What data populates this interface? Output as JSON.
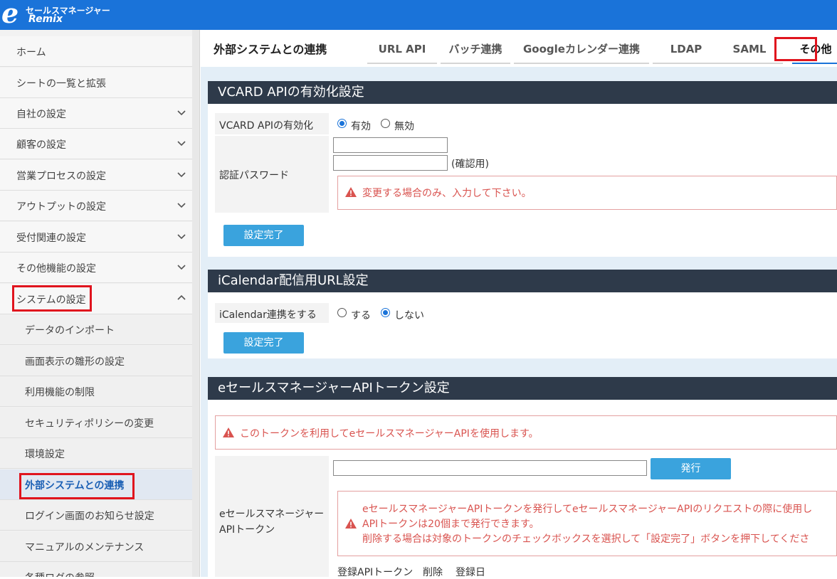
{
  "header": {
    "logo_e": "e",
    "logo_jp": "セールスマネージャー",
    "logo_remix": "Remix"
  },
  "sidebar": {
    "items": [
      {
        "label": "ホーム"
      },
      {
        "label": "シートの一覧と拡張"
      },
      {
        "label": "自社の設定"
      },
      {
        "label": "顧客の設定"
      },
      {
        "label": "営業プロセスの設定"
      },
      {
        "label": "アウトプットの設定"
      },
      {
        "label": "受付関連の設定"
      },
      {
        "label": "その他機能の設定"
      },
      {
        "label": "システムの設定"
      },
      {
        "label": "データのインポート"
      },
      {
        "label": "画面表示の雛形の設定"
      },
      {
        "label": "利用機能の制限"
      },
      {
        "label": "セキュリティポリシーの変更"
      },
      {
        "label": "環境設定"
      },
      {
        "label": "外部システムとの連携"
      },
      {
        "label": "ログイン画面のお知らせ設定"
      },
      {
        "label": "マニュアルのメンテナンス"
      },
      {
        "label": "各種ログの参照"
      }
    ]
  },
  "page": {
    "title": "外部システムとの連携",
    "tabs": [
      {
        "label": "URL API"
      },
      {
        "label": "バッチ連携"
      },
      {
        "label": "Googleカレンダー連携"
      },
      {
        "label": "LDAP"
      },
      {
        "label": "SAML"
      },
      {
        "label": "その他"
      }
    ]
  },
  "vcard": {
    "heading": "VCARD APIの有効化設定",
    "enable_label": "VCARD APIの有効化",
    "opt_on": "有効",
    "opt_off": "無効",
    "selected": "有効",
    "password_label": "認証パスワード",
    "password_value": "",
    "confirm_value": "",
    "confirm_note": "(確認用)",
    "warning": "変更する場合のみ、入力して下さい。",
    "submit": "設定完了"
  },
  "ical": {
    "heading": "iCalendar配信用URL設定",
    "label": "iCalendar連携をする",
    "opt_yes": "する",
    "opt_no": "しない",
    "selected": "しない",
    "submit": "設定完了"
  },
  "token": {
    "heading": "eセールスマネージャーAPIトークン設定",
    "notice": "このトークンを利用してeセールスマネージャーAPIを使用します。",
    "label_line1": "eセールスマネージャー",
    "label_line2": "APIトークン",
    "input_value": "",
    "issue_button": "発行",
    "info_line1": "eセールスマネージャーAPIトークンを発行してeセールスマネージャーAPIのリクエストの際に使用し",
    "info_line2": "APIトークンは20個まで発行できます。",
    "info_line3": "削除する場合は対象のトークンのチェックボックスを選択して「設定完了」ボタンを押下してくださ",
    "col_token": "登録APIトークン",
    "col_delete": "削除",
    "col_date": "登録日"
  },
  "colors": {
    "header": "#1a73d9",
    "card_head": "#2e3a4a",
    "button": "#3aa3dd",
    "alert_text": "#d9534f",
    "highlight": "#e0141e"
  }
}
